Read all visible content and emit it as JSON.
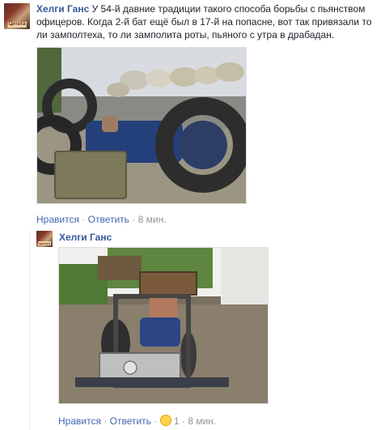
{
  "comments": [
    {
      "author": "Хелги Ганс",
      "text": "У 54-й давние традиции такого способа борьбы с пьянством офицеров. Когда 2-й бат ещё был в 17-й на попасне, вот так привязали то ли замполтеха, то ли замполита роты, пьяного с утра в драбадан.",
      "avatar_label": "Цитата",
      "actions": {
        "like": "Нравится",
        "reply": "Ответить",
        "time": "8 мин."
      }
    },
    {
      "author": "Хелги Ганс",
      "avatar_label": "Цитата",
      "actions": {
        "like": "Нравится",
        "reply": "Ответить",
        "reaction_icon": "laughing-emoji-icon",
        "reaction_count": "1",
        "time": "8 мин."
      }
    }
  ],
  "colors": {
    "link": "#365899",
    "action_link": "#4267b2",
    "meta": "#90949c"
  }
}
